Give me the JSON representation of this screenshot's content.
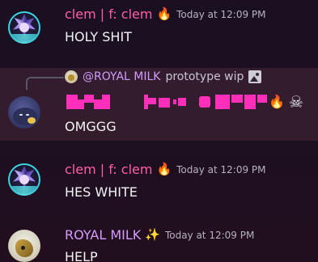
{
  "messages": [
    {
      "username": "clem | f: clem",
      "badge_emoji": "🔥",
      "timestamp": "Today at 12:09 PM",
      "text": "HOLY SHIT",
      "user_color": "#ff5fa8"
    },
    {
      "reply": {
        "username": "@ROYAL MILK",
        "text": "prototype wip",
        "attachment_icon": "image-icon"
      },
      "display_name_style": "stylized pixel text",
      "trailing_emojis": [
        "🔥",
        "☠"
      ],
      "text": "OMGGG"
    },
    {
      "username": "clem | f: clem",
      "badge_emoji": "🔥",
      "timestamp": "Today at 12:09 PM",
      "text": "HES WHITE",
      "user_color": "#ff5fa8"
    },
    {
      "username": "ROYAL MILK",
      "badge_emoji": "✨",
      "timestamp": "Today at 12:09 PM",
      "text": "HELP",
      "user_color": "#d39cff"
    }
  ]
}
